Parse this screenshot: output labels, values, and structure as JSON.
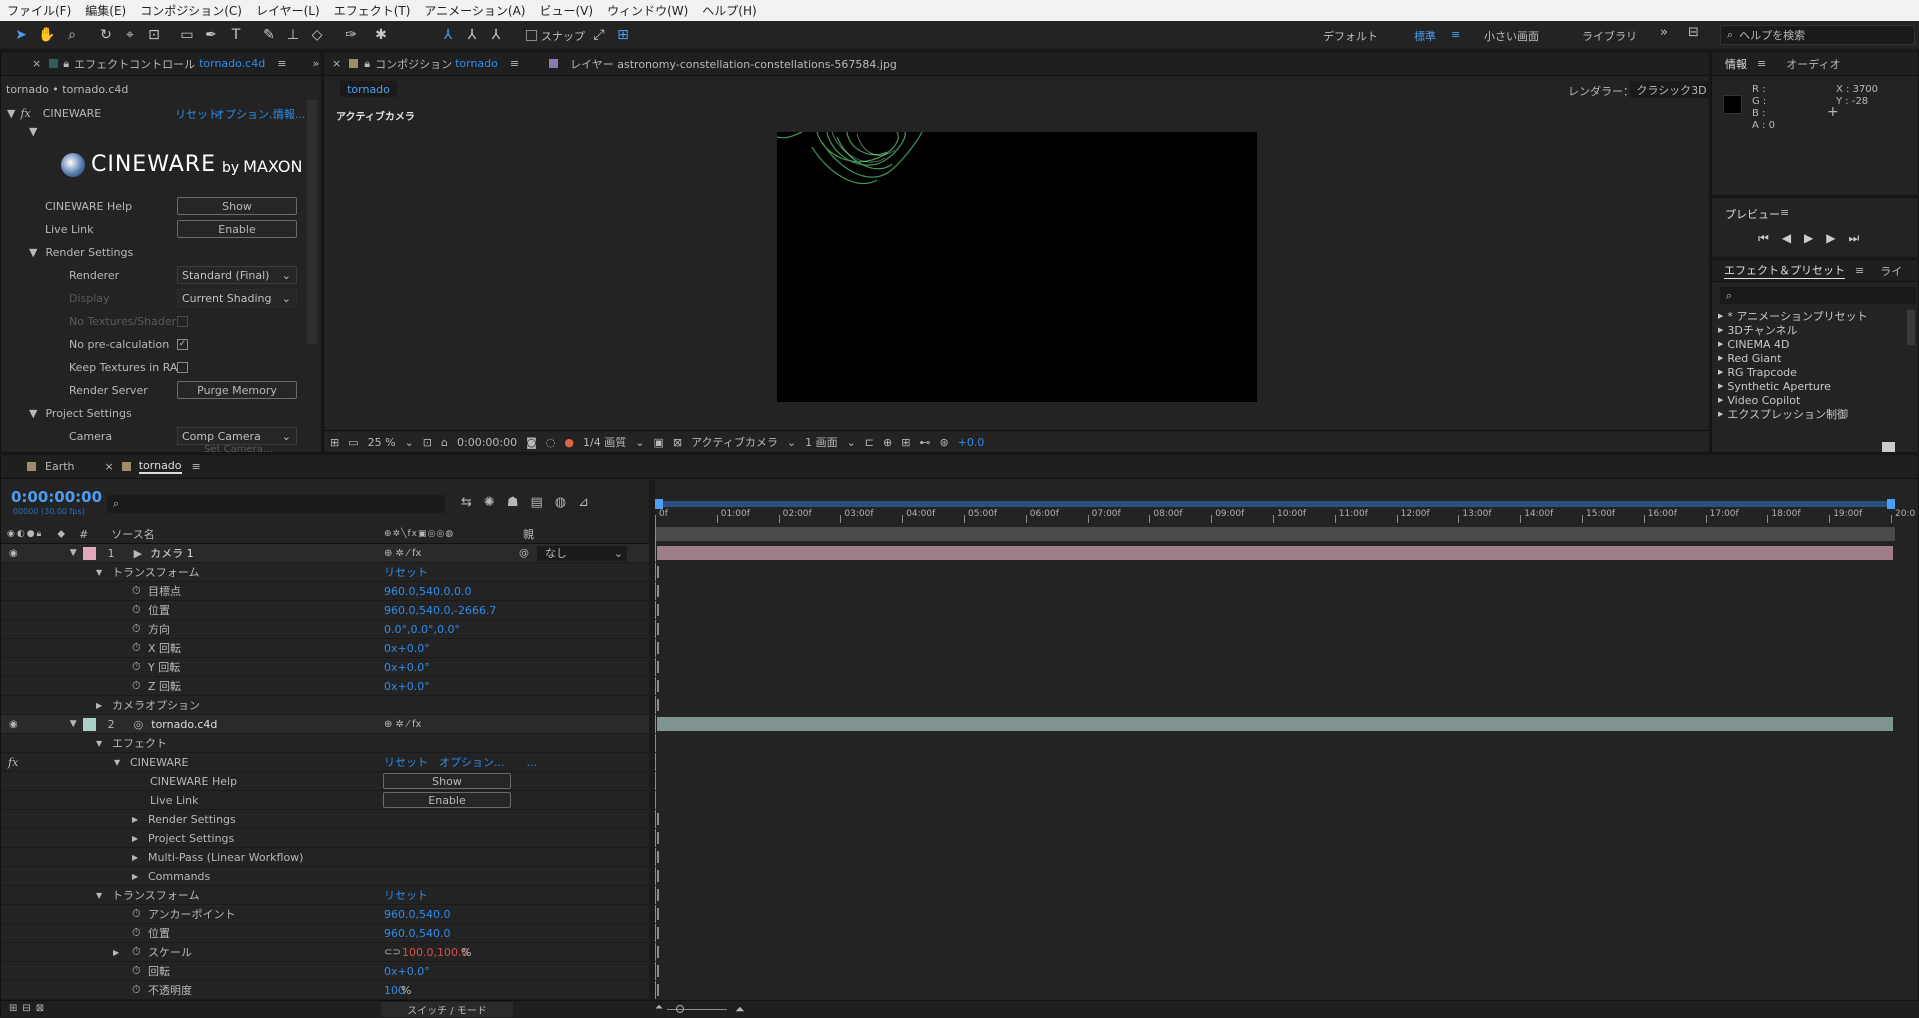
{
  "menu": [
    "ファイル(F)",
    "編集(E)",
    "コンポジション(C)",
    "レイヤー(L)",
    "エフェクト(T)",
    "アニメーション(A)",
    "ビュー(V)",
    "ウィンドウ(W)",
    "ヘルプ(H)"
  ],
  "toolbar": {
    "snap_label": "スナップ",
    "workspaces": [
      "デフォルト",
      "標準",
      "小さい画面",
      "ライブラリ"
    ],
    "search_placeholder": "ヘルプを検索"
  },
  "effect_panel": {
    "tab_label": "エフェクトコントロール",
    "tab_target": "tornado.c4d",
    "breadcrumb": "tornado • tornado.c4d",
    "fx_name": "CINEWARE",
    "links": [
      "リセット",
      "オプション...",
      "情報..."
    ],
    "logo_main": "CINEWARE",
    "logo_by": "by",
    "logo_maxon": "MAXON",
    "help_label": "CINEWARE Help",
    "help_btn": "Show",
    "live_label": "Live Link",
    "live_btn": "Enable",
    "render_settings": "Render Settings",
    "renderer_label": "Renderer",
    "renderer_value": "Standard (Final)",
    "display_label": "Display",
    "display_value": "Current Shading",
    "no_textures": "No Textures/Shader",
    "no_precalc": "No pre-calculation",
    "keep_textures": "Keep Textures in RA",
    "render_server": "Render Server",
    "purge_btn": "Purge Memory",
    "project_settings": "Project Settings",
    "camera_label": "Camera",
    "camera_value": "Comp Camera",
    "set_camera": "Set Camera..."
  },
  "comp_panel": {
    "tab_comp_prefix": "コンポジション",
    "tab_comp_name": "tornado",
    "tab_layer": "レイヤー astronomy-constellation-constellations-567584.jpg",
    "subtab": "tornado",
    "renderer_label": "レンダラー：",
    "renderer_value": "クラシック3D",
    "view_label": "アクティブカメラ",
    "zoom": "25 %",
    "timecode": "0:00:00:00",
    "resolution": "1/4 画質",
    "camera_view": "アクティブカメラ",
    "views": "1 画面",
    "exposure": "+0.0"
  },
  "info_panel": {
    "tab": "情報",
    "tab2": "オーディオ",
    "r": "R :",
    "g": "G :",
    "b": "B :",
    "a": "A : 0",
    "x": "X : 3700",
    "y": "Y : -28"
  },
  "preview_panel": {
    "title": "プレビュー"
  },
  "effects_presets": {
    "title": "エフェクト＆プリセット",
    "title2": "ライ",
    "items": [
      "* アニメーションプリセット",
      "3Dチャンネル",
      "CINEMA 4D",
      "Red Giant",
      "RG Trapcode",
      "Synthetic Aperture",
      "Video Copilot",
      "エクスプレッション制御"
    ]
  },
  "timeline": {
    "tabs": [
      "Earth",
      "tornado"
    ],
    "timecode": "0:00:00:00",
    "frame_info": "00000 (30.00 fps)",
    "col_num": "#",
    "col_source": "ソース名",
    "col_parent": "親",
    "ruler": [
      "0f",
      "01:00f",
      "02:00f",
      "03:00f",
      "04:00f",
      "05:00f",
      "06:00f",
      "07:00f",
      "08:00f",
      "09:00f",
      "10:00f",
      "11:00f",
      "12:00f",
      "13:00f",
      "14:00f",
      "15:00f",
      "16:00f",
      "17:00f",
      "18:00f",
      "19:00f",
      "20:0"
    ],
    "footer": "スイッチ / モード",
    "rows": [
      {
        "kind": "layer",
        "num": "1",
        "name": "カメラ 1",
        "parent": "なし",
        "color": "#e0a8b8",
        "bar": "#9e7f88"
      },
      {
        "kind": "group",
        "name": "トランスフォーム",
        "value": "リセット"
      },
      {
        "kind": "prop",
        "name": "目標点",
        "value": "960.0,540.0,0.0"
      },
      {
        "kind": "prop",
        "name": "位置",
        "value": "960.0,540.0,-2666.7"
      },
      {
        "kind": "prop",
        "name": "方向",
        "value": "0.0°,0.0°,0.0°"
      },
      {
        "kind": "prop",
        "name": "X 回転",
        "value": "0x+0.0°"
      },
      {
        "kind": "prop",
        "name": "Y 回転",
        "value": "0x+0.0°"
      },
      {
        "kind": "prop",
        "name": "Z 回転",
        "value": "0x+0.0°"
      },
      {
        "kind": "subgroup",
        "name": "カメラオプション"
      },
      {
        "kind": "layer",
        "num": "2",
        "name": "tornado.c4d",
        "color": "#a8d0c8",
        "bar": "#7f9490"
      },
      {
        "kind": "group",
        "name": "エフェクト"
      },
      {
        "kind": "fx",
        "name": "CINEWARE",
        "value": "リセット　オプション...　　..."
      },
      {
        "kind": "button",
        "name": "CINEWARE Help",
        "value": "Show"
      },
      {
        "kind": "button",
        "name": "Live Link",
        "value": "Enable"
      },
      {
        "kind": "sub",
        "name": "Render Settings"
      },
      {
        "kind": "sub",
        "name": "Project Settings"
      },
      {
        "kind": "sub",
        "name": "Multi-Pass (Linear Workflow)"
      },
      {
        "kind": "sub",
        "name": "Commands"
      },
      {
        "kind": "group",
        "name": "トランスフォーム",
        "value": "リセット"
      },
      {
        "kind": "prop",
        "name": "アンカーポイント",
        "value": "960.0,540.0"
      },
      {
        "kind": "prop",
        "name": "位置",
        "value": "960.0,540.0"
      },
      {
        "kind": "scale",
        "name": "スケール",
        "value": "100.0,100.0",
        "unit": "%"
      },
      {
        "kind": "prop",
        "name": "回転",
        "value": "0x+0.0°"
      },
      {
        "kind": "prop",
        "name": "不透明度",
        "value": "100",
        "unit": "%"
      }
    ]
  }
}
